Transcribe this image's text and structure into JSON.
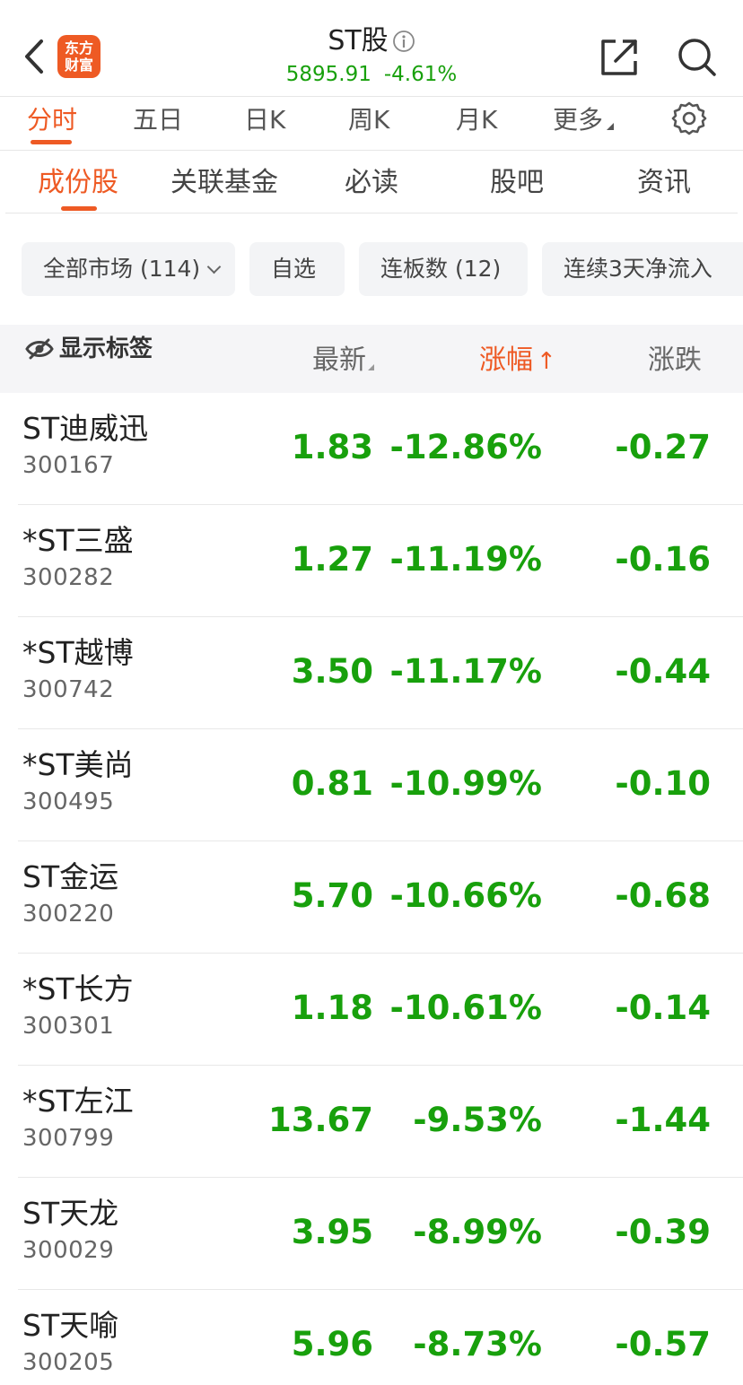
{
  "header": {
    "title": "ST股",
    "index_value": "5895.91",
    "index_change": "-4.61%",
    "logo_line1": "东方",
    "logo_line2": "财富"
  },
  "period_tabs": [
    "分时",
    "五日",
    "日K",
    "周K",
    "月K",
    "更多"
  ],
  "section_tabs": [
    "成份股",
    "关联基金",
    "必读",
    "股吧",
    "资讯"
  ],
  "filters": [
    "全部市场 (114)",
    "自选",
    "连板数 (12)",
    "连续3天净流入"
  ],
  "columns": {
    "show_tags": "显示标签",
    "latest": "最新",
    "change_pct": "涨幅",
    "change": "涨跌"
  },
  "colors": {
    "accent": "#ee5a24",
    "down": "#18a00c"
  },
  "stocks": [
    {
      "name": "ST迪威迅",
      "code": "300167",
      "price": "1.83",
      "pct": "-12.86%",
      "chg": "-0.27"
    },
    {
      "name": "*ST三盛",
      "code": "300282",
      "price": "1.27",
      "pct": "-11.19%",
      "chg": "-0.16"
    },
    {
      "name": "*ST越博",
      "code": "300742",
      "price": "3.50",
      "pct": "-11.17%",
      "chg": "-0.44"
    },
    {
      "name": "*ST美尚",
      "code": "300495",
      "price": "0.81",
      "pct": "-10.99%",
      "chg": "-0.10"
    },
    {
      "name": "ST金运",
      "code": "300220",
      "price": "5.70",
      "pct": "-10.66%",
      "chg": "-0.68"
    },
    {
      "name": "*ST长方",
      "code": "300301",
      "price": "1.18",
      "pct": "-10.61%",
      "chg": "-0.14"
    },
    {
      "name": "*ST左江",
      "code": "300799",
      "price": "13.67",
      "pct": "-9.53%",
      "chg": "-1.44"
    },
    {
      "name": "ST天龙",
      "code": "300029",
      "price": "3.95",
      "pct": "-8.99%",
      "chg": "-0.39"
    },
    {
      "name": "ST天喻",
      "code": "300205",
      "price": "5.96",
      "pct": "-8.73%",
      "chg": "-0.57"
    }
  ]
}
